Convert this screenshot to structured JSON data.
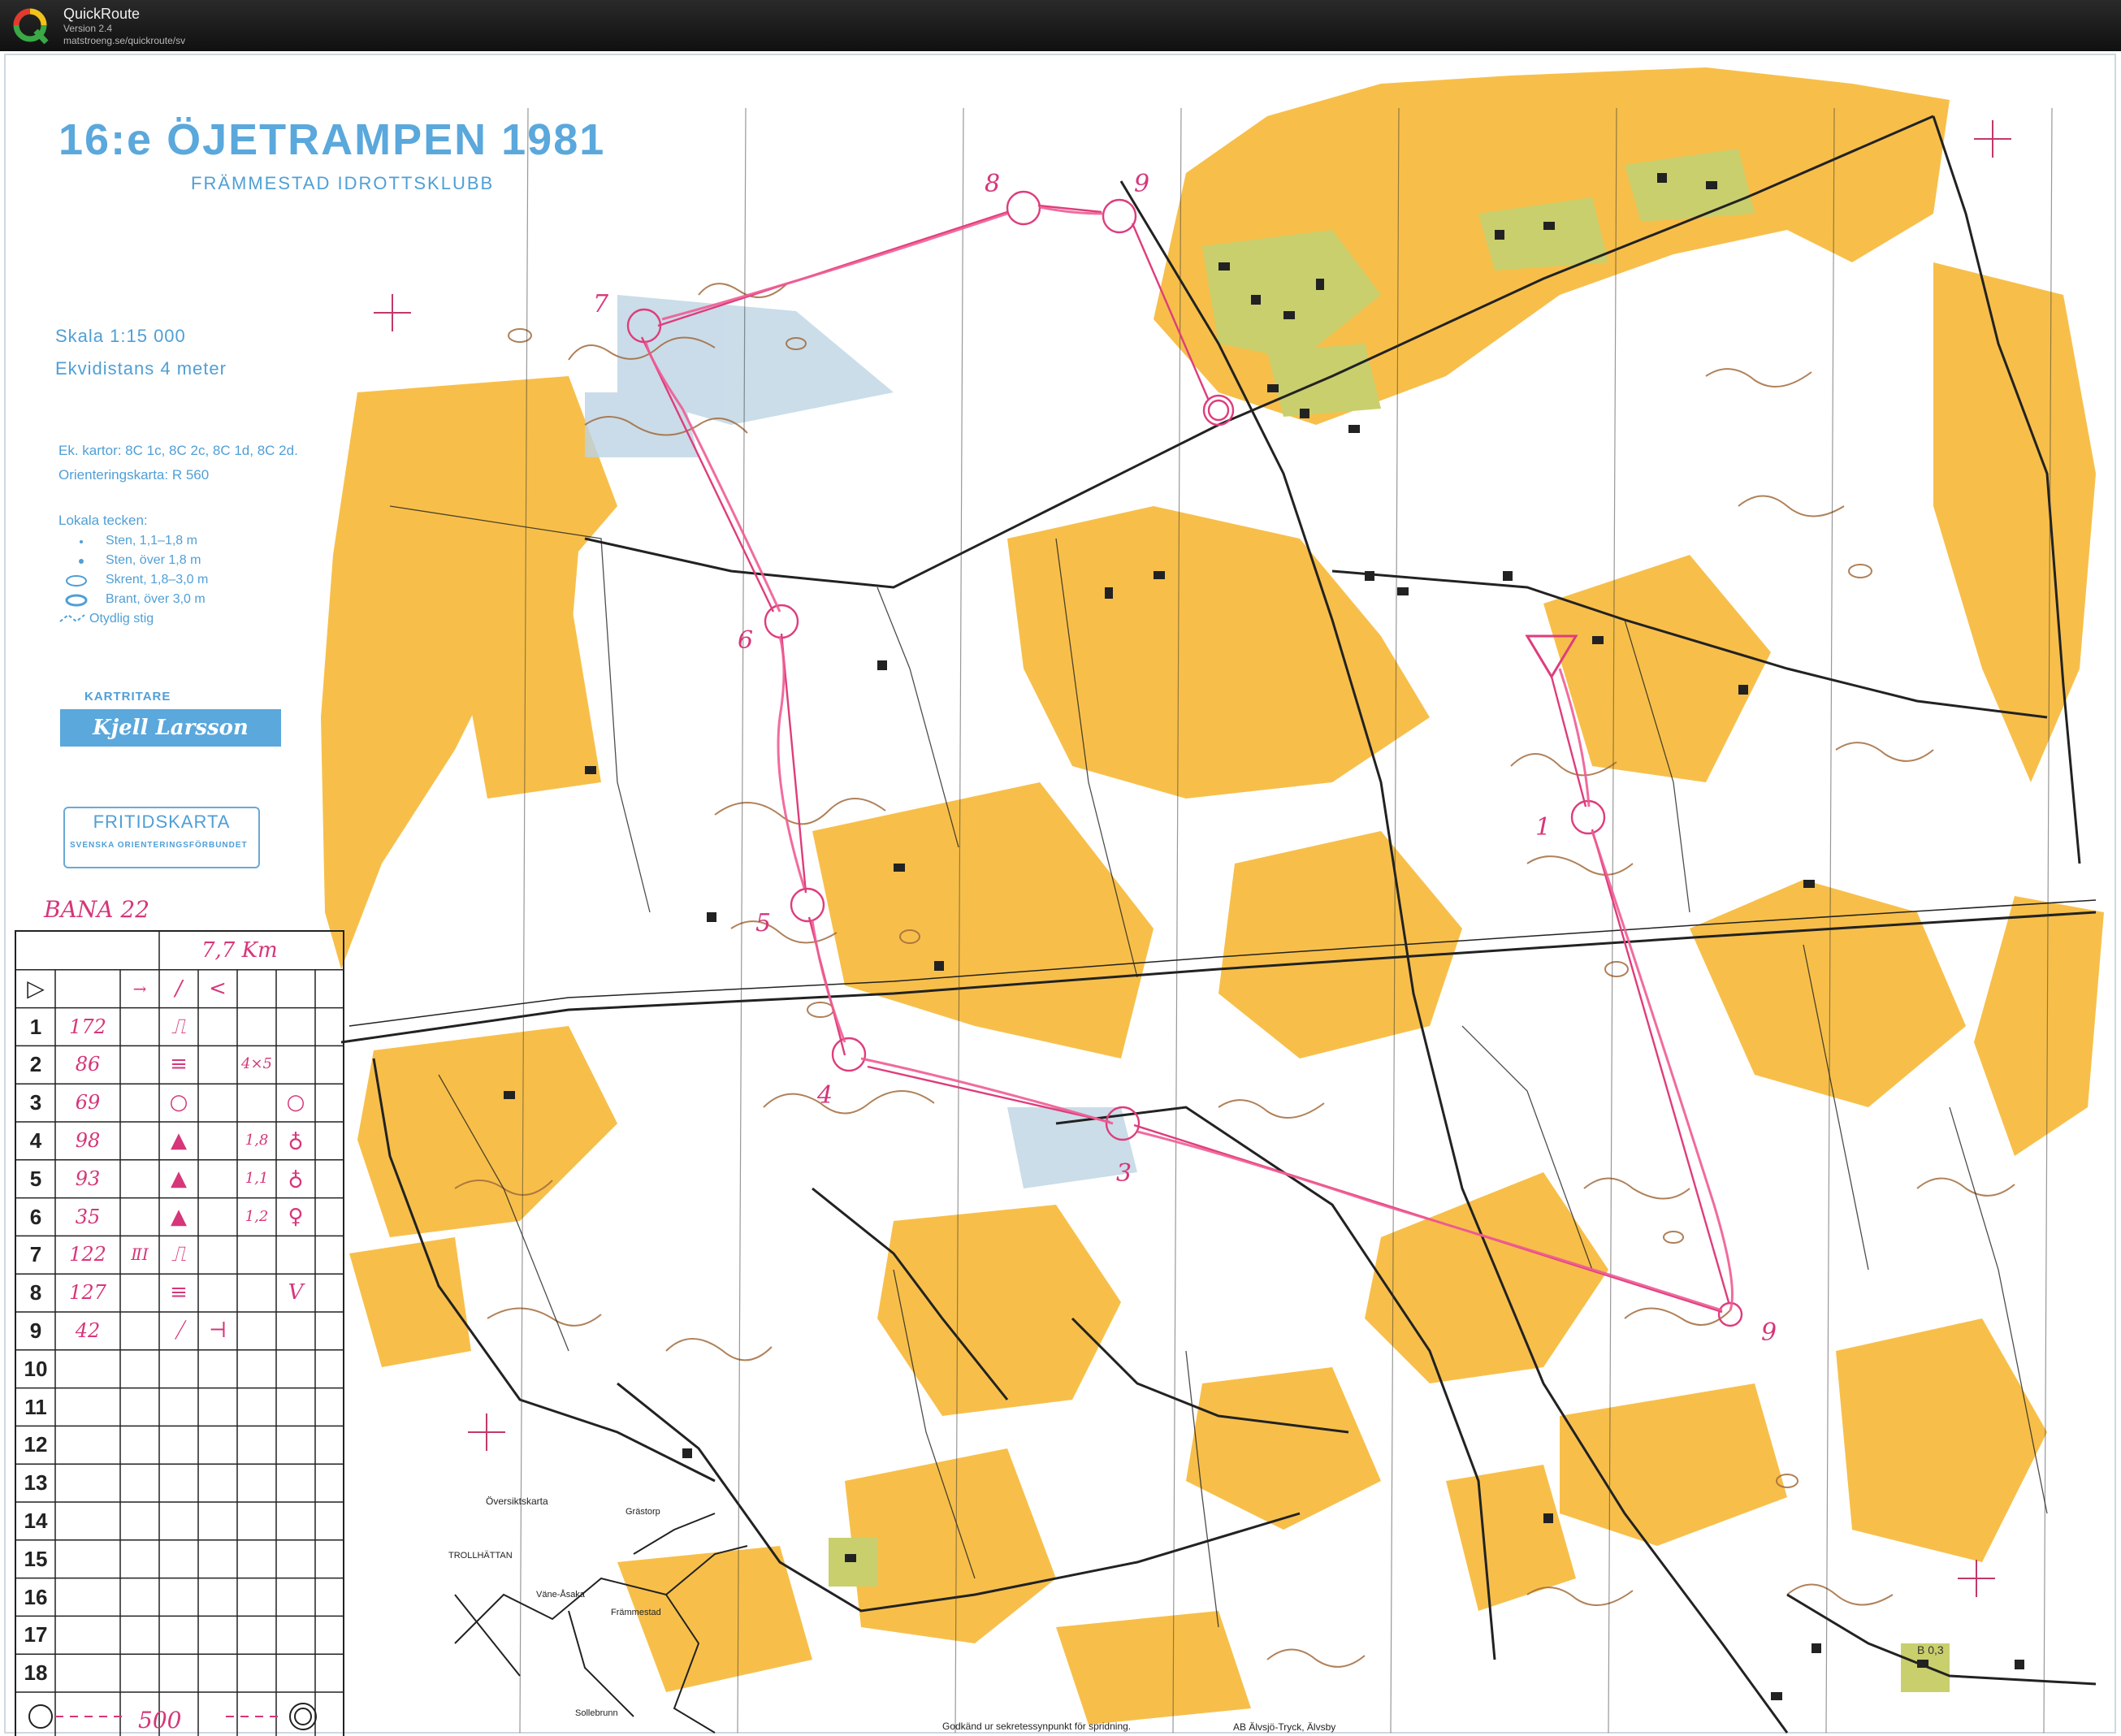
{
  "app": {
    "title": "QuickRoute",
    "version": "Version 2.4",
    "url": "matstroeng.se/quickroute/sv"
  },
  "map": {
    "title": "16:e ÖJETRAMPEN 1981",
    "club": "FRÄMMESTAD IDROTTSKLUBB",
    "scale": "Skala   1:15 000",
    "equidistance": "Ekvidistans   4 meter",
    "ek_maps": "Ek. kartor: 8C 1c, 8C 2c, 8C 1d, 8C 2d.",
    "orienteering_map": "Orienteringskarta: R 560",
    "legend": {
      "title": "Lokala tecken:",
      "items": [
        "Sten,  1,1–1,8 m",
        "Sten,  över 1,8 m",
        "Skrent,  1,8–3,0 m",
        "Brant,  över  3,0 m",
        "Otydlig stig"
      ]
    },
    "cartographer_label": "KARTRITARE",
    "cartographer": "Kjell Larsson",
    "fritid_title": "FRITIDSKARTA",
    "fritid_sub": "SVENSKA   ORIENTERINGSFÖRBUNDET",
    "overview_label": "Översiktskarta",
    "towns": [
      "Grästorp",
      "TROLLHÄTTAN",
      "Väne-Åsaka",
      "Främmestad",
      "Sollebrunn"
    ],
    "footer_note": "Godkänd ur sekretessynpunkt för spridning.",
    "printer": "AB Älvsjö-Tryck, Älvsby",
    "sheet_code": "B 0,3",
    "colors": {
      "field": "#f7bf4a",
      "forest": "#ffffff",
      "contour": "#a26b3c",
      "road": "#222222",
      "marsh": "#bdd4e4",
      "course": "#de3d7c",
      "magenta_ink": "#d6367a",
      "blue_text": "#5aa8dc",
      "village_green": "#c9cf6d"
    },
    "controls_on_map": [
      "1",
      "3",
      "4",
      "5",
      "6",
      "7",
      "8",
      "9",
      "9"
    ]
  },
  "description_sheet": {
    "course": "BANA 22",
    "distance": "7,7 Km",
    "start_symbol": "▷",
    "start_row": [
      "→",
      "/",
      "<"
    ],
    "rows": [
      {
        "n": "1",
        "code": "172",
        "d1": "",
        "d2": "⎍",
        "d3": "",
        "d4": "",
        "d5": ""
      },
      {
        "n": "2",
        "code": "86",
        "d1": "",
        "d2": "≡",
        "d3": "",
        "d4": "4×5",
        "d5": ""
      },
      {
        "n": "3",
        "code": "69",
        "d1": "",
        "d2": "○",
        "d3": "",
        "d4": "",
        "d5": "○"
      },
      {
        "n": "4",
        "code": "98",
        "d1": "",
        "d2": "▲",
        "d3": "",
        "d4": "1,8",
        "d5": "♁"
      },
      {
        "n": "5",
        "code": "93",
        "d1": "",
        "d2": "▲",
        "d3": "",
        "d4": "1,1",
        "d5": "♁"
      },
      {
        "n": "6",
        "code": "35",
        "d1": "",
        "d2": "▲",
        "d3": "",
        "d4": "1,2",
        "d5": "♀"
      },
      {
        "n": "7",
        "code": "122",
        "d1": "ⅡⅠ",
        "d2": "⎍",
        "d3": "",
        "d4": "",
        "d5": ""
      },
      {
        "n": "8",
        "code": "127",
        "d1": "",
        "d2": "≡",
        "d3": "",
        "d4": "",
        "d5": "V"
      },
      {
        "n": "9",
        "code": "42",
        "d1": "",
        "d2": "⧸",
        "d3": "⊣",
        "d4": "",
        "d5": ""
      },
      {
        "n": "10",
        "code": ""
      },
      {
        "n": "11",
        "code": ""
      },
      {
        "n": "12",
        "code": ""
      },
      {
        "n": "13",
        "code": ""
      },
      {
        "n": "14",
        "code": ""
      },
      {
        "n": "15",
        "code": ""
      },
      {
        "n": "16",
        "code": ""
      },
      {
        "n": "17",
        "code": ""
      },
      {
        "n": "18",
        "code": ""
      }
    ],
    "finish_distance": "500"
  }
}
